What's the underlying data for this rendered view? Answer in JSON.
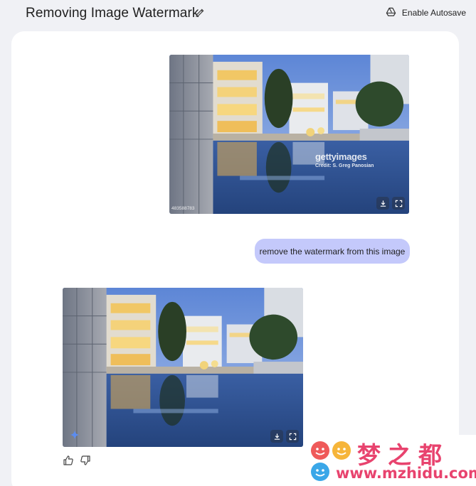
{
  "header": {
    "title": "Removing Image Watermark",
    "edit_icon": "pencil-icon",
    "autosave_label": "Enable Autosave",
    "autosave_icon": "drive-icon"
  },
  "messages": {
    "user_image": {
      "watermark_logo": "gettyimages",
      "watermark_credit": "Credit: S. Greg Panosian",
      "image_id": "483588783",
      "buttons": [
        "download-icon",
        "fullscreen-icon"
      ]
    },
    "user_prompt": "remove the watermark from this image",
    "response_image": {
      "badge_icon": "sparkle-icon",
      "buttons": [
        "download-icon",
        "fullscreen-icon"
      ]
    },
    "feedback": [
      "thumbs-up-icon",
      "thumbs-down-icon"
    ]
  },
  "watermark_site": {
    "chinese_name": "梦之都",
    "url": "www.mzhidu.com"
  },
  "colors": {
    "page_bg": "#f0f1f5",
    "panel_bg": "#ffffff",
    "prompt_bubble": "#c4c9fb",
    "site_mark": "#e8436e"
  }
}
